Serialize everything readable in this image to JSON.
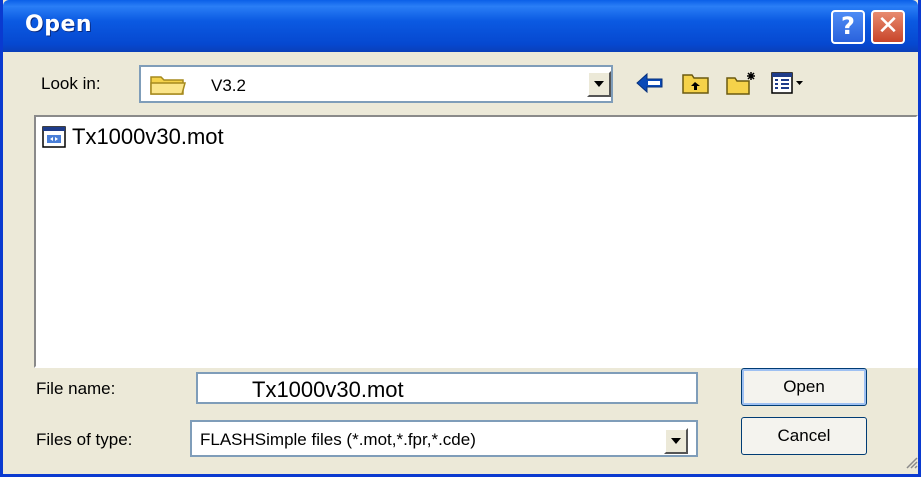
{
  "window": {
    "title": "Open"
  },
  "titlebar": {
    "help_label": "?",
    "close_label": "✕"
  },
  "lookin": {
    "label": "Look in:",
    "value": "V3.2",
    "folder_icon": "folder-icon"
  },
  "toolbar": {
    "icons": [
      "back-arrow-icon",
      "up-one-level-icon",
      "new-folder-icon",
      "view-menu-icon"
    ],
    "colors": {
      "arrow": "#0a4ab8",
      "folder": "#f5d24a"
    }
  },
  "files": [
    {
      "name": "Tx1000v30.mot",
      "icon": "mot-file-icon"
    }
  ],
  "filename": {
    "label": "File name:",
    "value": "Tx1000v30.mot"
  },
  "filetype": {
    "label": "Files of type:",
    "value": "FLASHSimple files (*.mot,*.fpr,*.cde)"
  },
  "buttons": {
    "open": "Open",
    "cancel": "Cancel"
  }
}
